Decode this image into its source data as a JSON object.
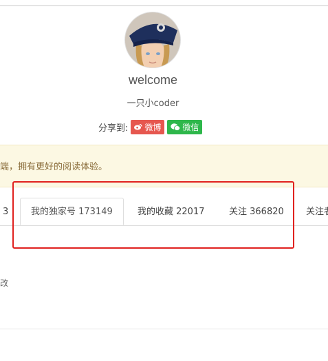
{
  "profile": {
    "name": "welcome",
    "subtitle": "一只小coder"
  },
  "share": {
    "label": "分享到:",
    "buttons": [
      {
        "label": "微博",
        "icon": "weibo-icon",
        "color": "#e6574f"
      },
      {
        "label": "微信",
        "icon": "wechat-icon",
        "color": "#2eb74b"
      }
    ]
  },
  "notice": {
    "text": "端，拥有更好的阅读体验。",
    "background": "#fcf8e3"
  },
  "tabs": [
    {
      "label": "3"
    },
    {
      "label": "我的独家号 173149",
      "active": true
    },
    {
      "label": "我的收藏 22017"
    },
    {
      "label": "关注 366820"
    },
    {
      "label": "关注者"
    }
  ],
  "content": {
    "fragment": "改"
  },
  "highlight_color": "#e0211f"
}
